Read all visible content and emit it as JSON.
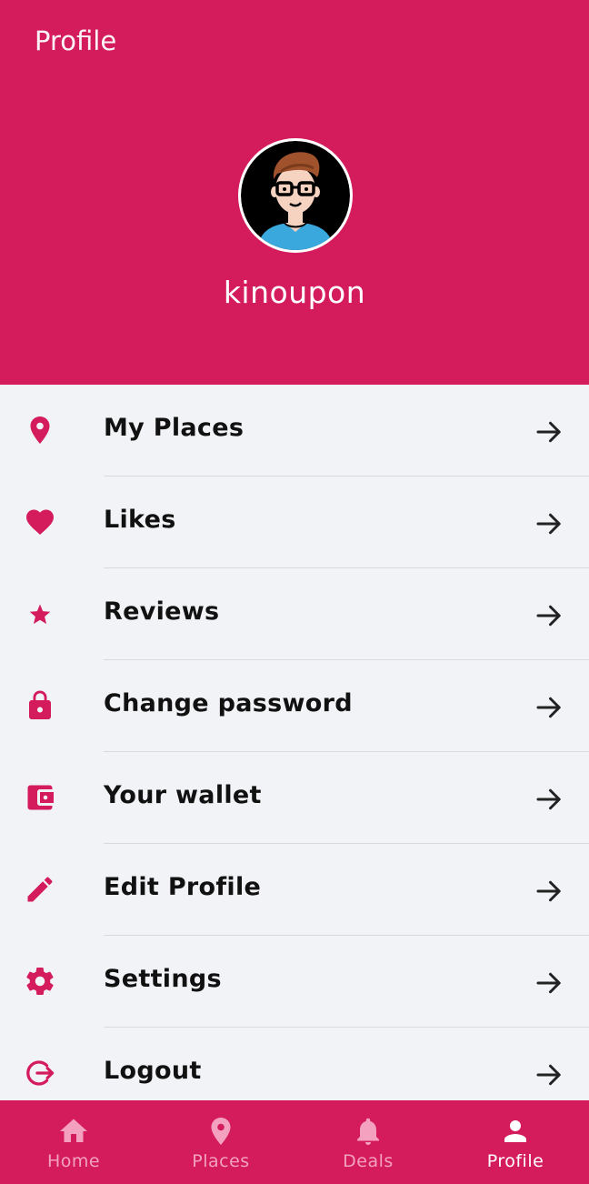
{
  "header": {
    "title": "Profile",
    "username": "kinoupon"
  },
  "menu": {
    "items": [
      {
        "label": "My Places",
        "icon": "map-pin-icon"
      },
      {
        "label": "Likes",
        "icon": "heart-icon"
      },
      {
        "label": "Reviews",
        "icon": "star-icon"
      },
      {
        "label": "Change password",
        "icon": "lock-icon"
      },
      {
        "label": "Your wallet",
        "icon": "wallet-icon"
      },
      {
        "label": "Edit Profile",
        "icon": "pencil-icon"
      },
      {
        "label": "Settings",
        "icon": "gear-icon"
      },
      {
        "label": "Logout",
        "icon": "logout-icon"
      }
    ]
  },
  "bottom_nav": {
    "items": [
      {
        "label": "Home",
        "icon": "home-icon",
        "active": false
      },
      {
        "label": "Places",
        "icon": "map-pin-icon",
        "active": false
      },
      {
        "label": "Deals",
        "icon": "bell-icon",
        "active": false
      },
      {
        "label": "Profile",
        "icon": "person-icon",
        "active": true
      }
    ]
  },
  "colors": {
    "brand": "#d41c5c",
    "background": "#f2f3f7",
    "text": "#111111",
    "nav_inactive": "#f4a1bf",
    "divider": "#d8d9de"
  }
}
